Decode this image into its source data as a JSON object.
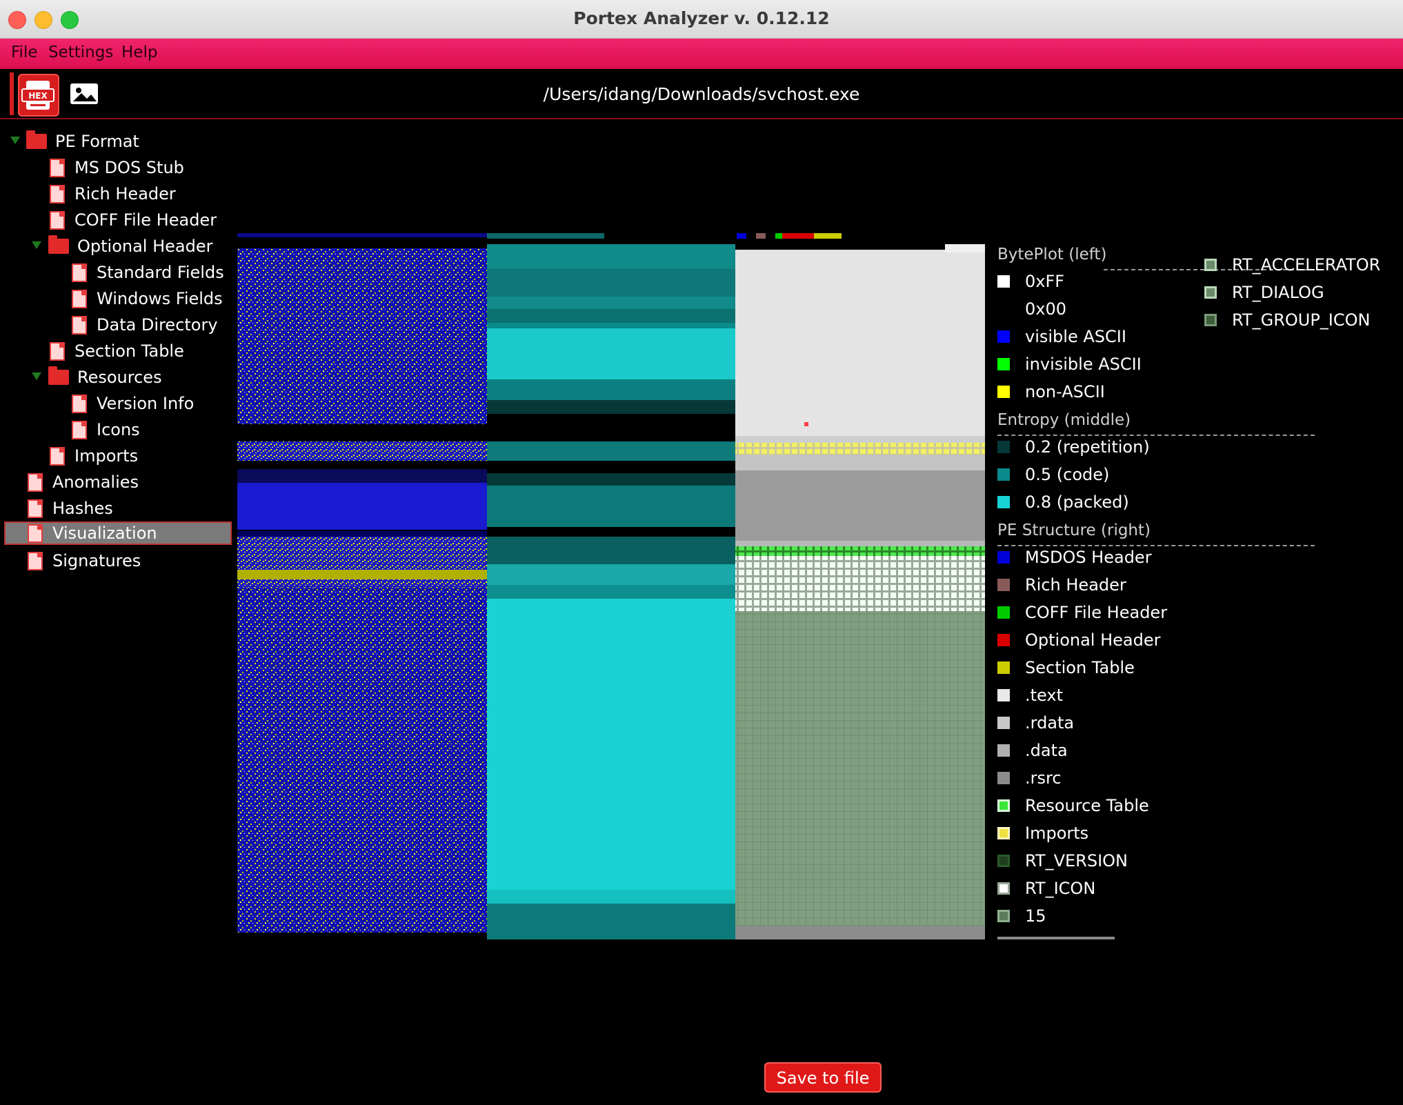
{
  "window": {
    "title": "Portex Analyzer v. 0.12.12"
  },
  "menu": [
    "File",
    "Settings",
    "Help"
  ],
  "toolbar": {
    "file_path": "/Users/idang/Downloads/svchost.exe",
    "buttons": [
      "hex-view-icon",
      "image-icon"
    ],
    "hex_label": "HEX"
  },
  "tree": [
    {
      "label": "PE Format",
      "type": "folder",
      "expanded": true
    },
    {
      "label": "MS DOS Stub",
      "type": "doc"
    },
    {
      "label": "Rich Header",
      "type": "doc"
    },
    {
      "label": "COFF File Header",
      "type": "doc"
    },
    {
      "label": "Optional Header",
      "type": "folder",
      "expanded": true
    },
    {
      "label": "Standard Fields",
      "type": "doc"
    },
    {
      "label": "Windows Fields",
      "type": "doc"
    },
    {
      "label": "Data Directory",
      "type": "doc"
    },
    {
      "label": "Section Table",
      "type": "doc"
    },
    {
      "label": "Resources",
      "type": "folder",
      "expanded": true
    },
    {
      "label": "Version Info",
      "type": "doc"
    },
    {
      "label": "Icons",
      "type": "doc"
    },
    {
      "label": "Imports",
      "type": "doc"
    },
    {
      "label": "Anomalies",
      "type": "doc"
    },
    {
      "label": "Hashes",
      "type": "doc"
    },
    {
      "label": "Visualization",
      "type": "doc",
      "selected": true
    },
    {
      "label": "Signatures",
      "type": "doc"
    }
  ],
  "legend": {
    "byteplot_title": "BytePlot (left)",
    "byteplot": [
      {
        "label": "0xFF",
        "color": "#ffffff"
      },
      {
        "label": "0x00",
        "color": "#000000"
      },
      {
        "label": "visible ASCII",
        "color": "#0000ff"
      },
      {
        "label": "invisible ASCII",
        "color": "#00ff00"
      },
      {
        "label": "non-ASCII",
        "color": "#ffff00"
      }
    ],
    "entropy_title": "Entropy (middle)",
    "entropy": [
      {
        "label": "0.2 (repetition)",
        "color": "#073838"
      },
      {
        "label": "0.5 (code)",
        "color": "#0a8a8a"
      },
      {
        "label": "0.8 (packed)",
        "color": "#19d4d4"
      }
    ],
    "pe_title": "PE Structure (right)",
    "pe": [
      {
        "label": "MSDOS Header",
        "color": "#0000d8"
      },
      {
        "label": "Rich Header",
        "color": "#8a5a5a"
      },
      {
        "label": "COFF File Header",
        "color": "#00cc00"
      },
      {
        "label": "Optional Header",
        "color": "#d80000"
      },
      {
        "label": "Section Table",
        "color": "#cccc00"
      },
      {
        "label": ".text",
        "color": "#e8e8e8"
      },
      {
        "label": ".rdata",
        "color": "#c8c8c8"
      },
      {
        "label": ".data",
        "color": "#b0b0b0"
      },
      {
        "label": ".rsrc",
        "color": "#8c8c8c"
      },
      {
        "label": "Resource Table",
        "color": "#39e639",
        "outlined": true
      },
      {
        "label": "Imports",
        "color": "#f0e040",
        "outlined": true
      },
      {
        "label": "RT_VERSION",
        "color": "#2a5a2a",
        "outlined": true
      },
      {
        "label": "RT_ICON",
        "color": "#ffffff",
        "outlined": true
      },
      {
        "label": "15",
        "color": "#7aa07a",
        "outlined": true
      }
    ],
    "pe_extra": [
      {
        "label": "RT_ACCELERATOR",
        "color": "#8fb08f"
      },
      {
        "label": "RT_DIALOG",
        "color": "#8fb08f"
      },
      {
        "label": "RT_GROUP_ICON",
        "color": "#6a8a6a"
      }
    ]
  },
  "save_button": "Save to file"
}
